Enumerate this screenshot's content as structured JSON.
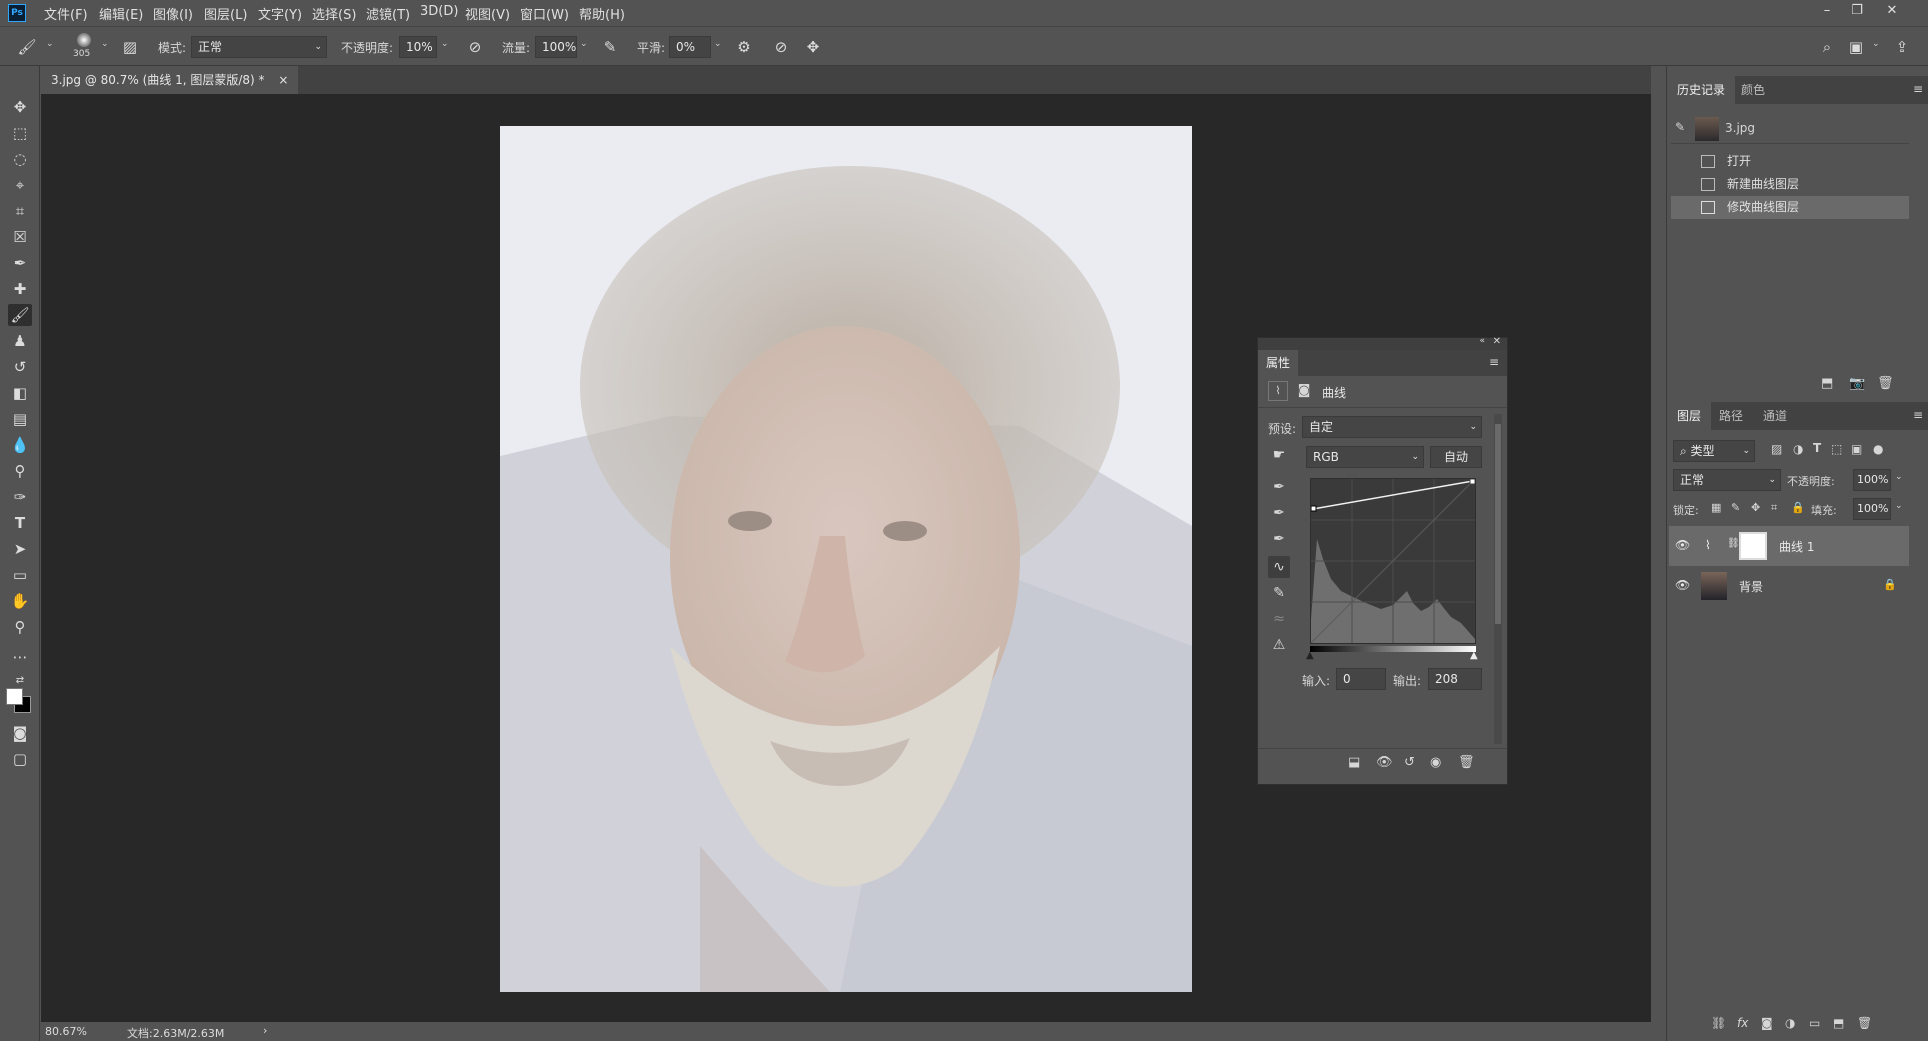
{
  "app": {
    "logo": "Ps"
  },
  "menu": [
    "文件(F)",
    "编辑(E)",
    "图像(I)",
    "图层(L)",
    "文字(Y)",
    "选择(S)",
    "滤镜(T)",
    "3D(D)",
    "视图(V)",
    "窗口(W)",
    "帮助(H)"
  ],
  "window_controls": {
    "minimize": "–",
    "restore": "❐",
    "close": "✕"
  },
  "options": {
    "brush_size": "305",
    "mode_label": "模式:",
    "mode_value": "正常",
    "opacity_label": "不透明度:",
    "opacity_value": "10%",
    "flow_label": "流量:",
    "flow_value": "100%",
    "smoothing_label": "平滑:",
    "smoothing_value": "0%"
  },
  "document": {
    "tab_title": "3.jpg @ 80.7% (曲线 1, 图层蒙版/8) *",
    "tab_close": "×",
    "zoom": "80.67%",
    "doc_info": "文档:2.63M/2.63M",
    "status_arrow": "›"
  },
  "history_panel": {
    "tabs": [
      "历史记录",
      "颜色"
    ],
    "snapshot": "3.jpg",
    "items": [
      "打开",
      "新建曲线图层",
      "修改曲线图层"
    ]
  },
  "layers_panel": {
    "tabs": [
      "图层",
      "路径",
      "通道"
    ],
    "filter_label": "类型",
    "blend_mode": "正常",
    "opacity_label": "不透明度:",
    "opacity_value": "100%",
    "lock_label": "锁定:",
    "fill_label": "填充:",
    "fill_value": "100%",
    "layers": [
      {
        "name": "曲线 1"
      },
      {
        "name": "背景"
      }
    ]
  },
  "properties_panel": {
    "tab": "属性",
    "type_label": "曲线",
    "preset_label": "预设:",
    "preset_value": "自定",
    "channel_value": "RGB",
    "auto_label": "自动",
    "input_label": "输入:",
    "input_value": "0",
    "output_label": "输出:",
    "output_value": "208"
  }
}
